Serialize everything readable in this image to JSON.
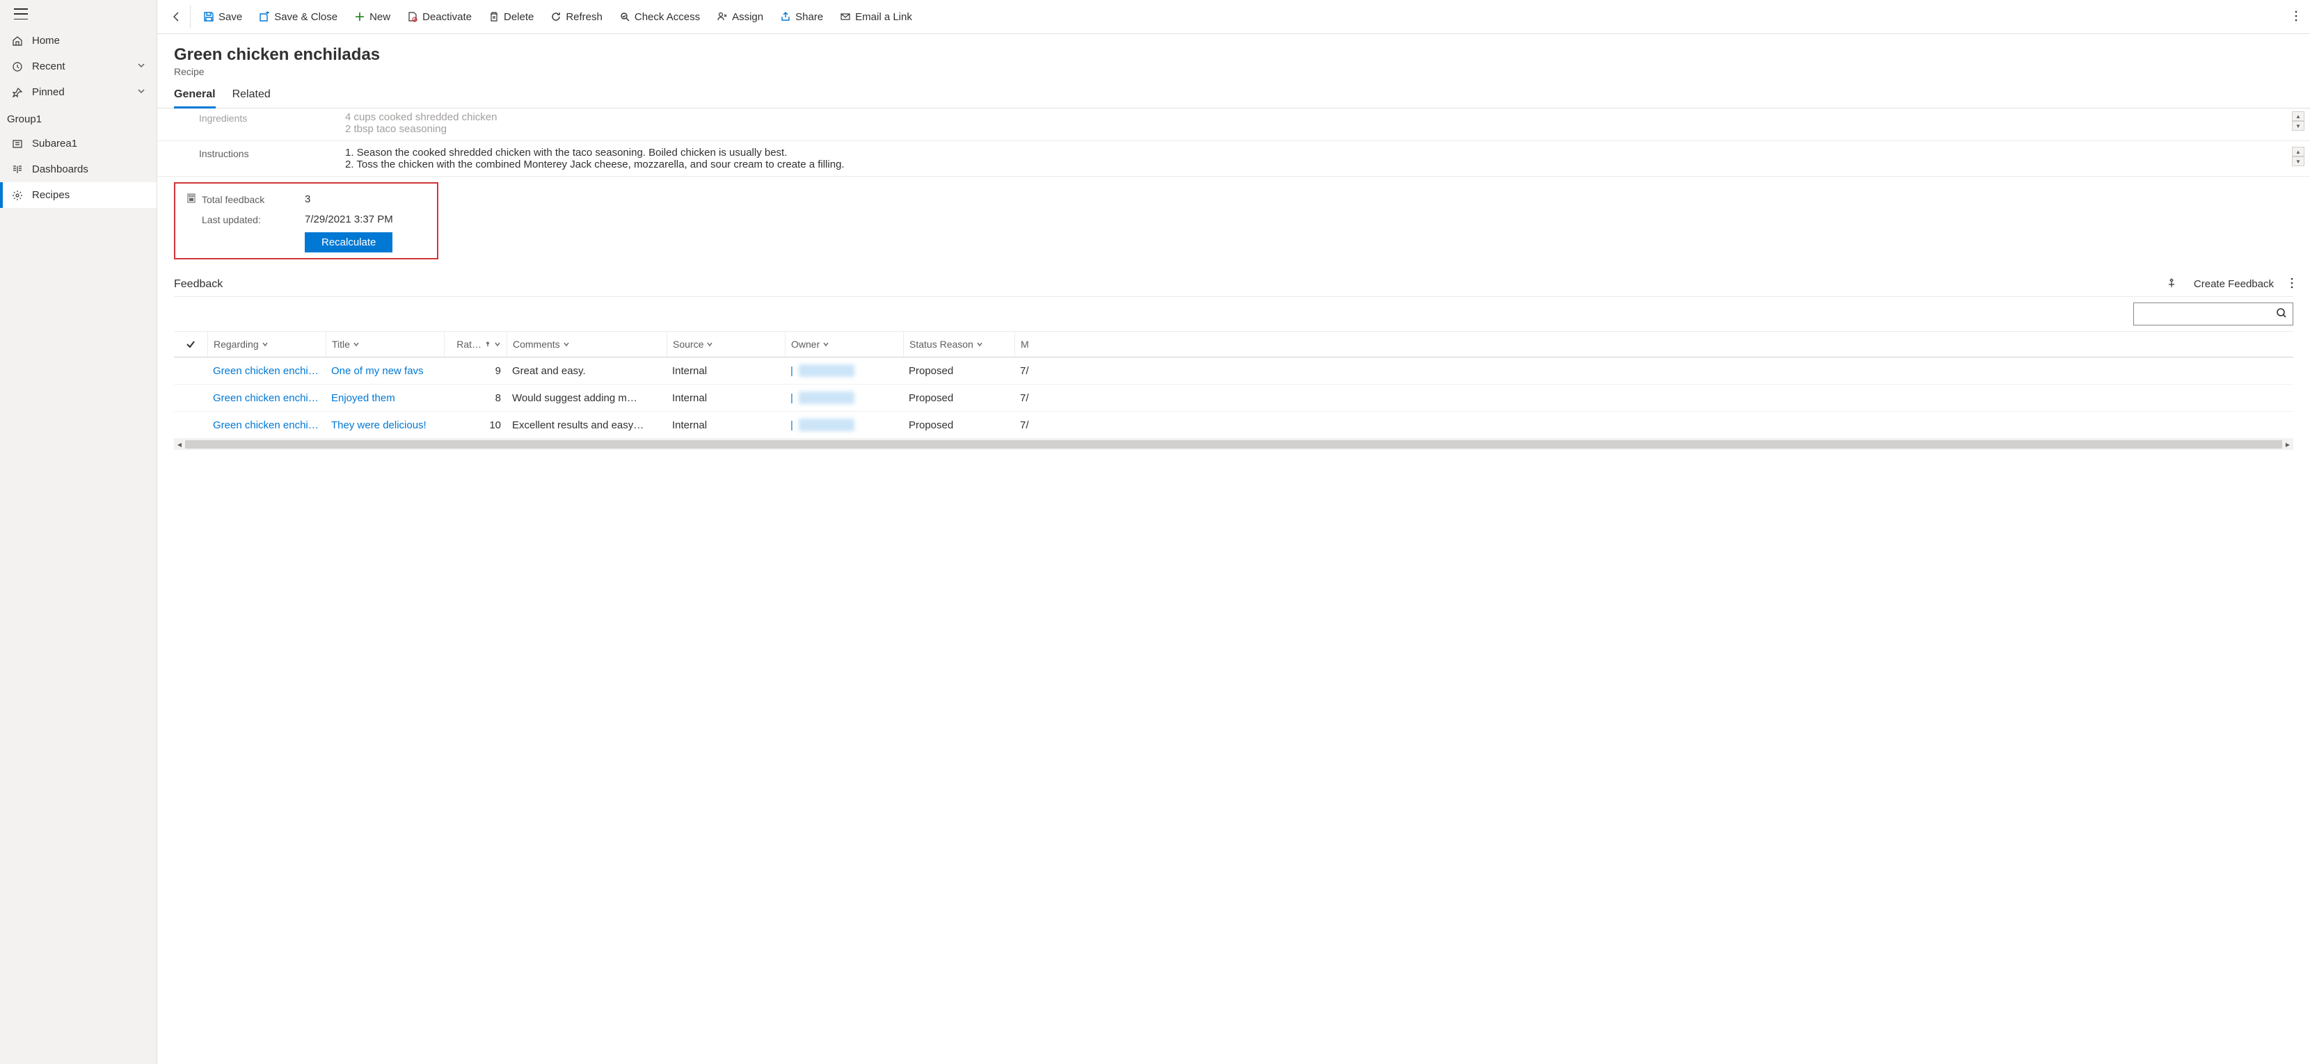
{
  "sidebar": {
    "items": [
      {
        "label": "Home",
        "icon": "home"
      },
      {
        "label": "Recent",
        "icon": "clock",
        "expandable": true
      },
      {
        "label": "Pinned",
        "icon": "pin",
        "expandable": true
      }
    ],
    "group_label": "Group1",
    "group_items": [
      {
        "label": "Subarea1",
        "icon": "square"
      },
      {
        "label": "Dashboards",
        "icon": "dashboard"
      },
      {
        "label": "Recipes",
        "icon": "gear",
        "selected": true
      }
    ]
  },
  "cmdbar": {
    "save": "Save",
    "save_close": "Save & Close",
    "new": "New",
    "deactivate": "Deactivate",
    "delete": "Delete",
    "refresh": "Refresh",
    "check_access": "Check Access",
    "assign": "Assign",
    "share": "Share",
    "email_link": "Email a Link"
  },
  "header": {
    "title": "Green chicken enchiladas",
    "subtitle": "Recipe"
  },
  "tabs": {
    "general": "General",
    "related": "Related"
  },
  "form": {
    "ingredients_label": "Ingredients",
    "ingredients_value": "4 cups cooked shredded chicken\n2 tbsp taco seasoning",
    "instructions_label": "Instructions",
    "instructions_value": "1. Season the cooked shredded chicken with the taco seasoning. Boiled chicken is usually best.\n2. Toss the chicken with the combined Monterey Jack cheese, mozzarella, and sour cream to create a filling."
  },
  "rollup": {
    "total_label": "Total feedback",
    "total_value": "3",
    "updated_label": "Last updated:",
    "updated_value": "7/29/2021 3:37 PM",
    "recalc_label": "Recalculate"
  },
  "feedback_section": {
    "title": "Feedback",
    "create_label": "Create Feedback"
  },
  "grid": {
    "columns": {
      "regarding": "Regarding",
      "title": "Title",
      "rating": "Rat…",
      "comments": "Comments",
      "source": "Source",
      "owner": "Owner",
      "status": "Status Reason",
      "modified": "M"
    },
    "rows": [
      {
        "regarding": "Green chicken enchilad",
        "title": "One of my new favs",
        "rating": "9",
        "comments": "Great and easy.",
        "source": "Internal",
        "status": "Proposed",
        "modified": "7/"
      },
      {
        "regarding": "Green chicken enchilad",
        "title": "Enjoyed them",
        "rating": "8",
        "comments": "Would suggest adding m…",
        "source": "Internal",
        "status": "Proposed",
        "modified": "7/"
      },
      {
        "regarding": "Green chicken enchilad",
        "title": "They were delicious!",
        "rating": "10",
        "comments": "Excellent results and easy…",
        "source": "Internal",
        "status": "Proposed",
        "modified": "7/"
      }
    ]
  }
}
